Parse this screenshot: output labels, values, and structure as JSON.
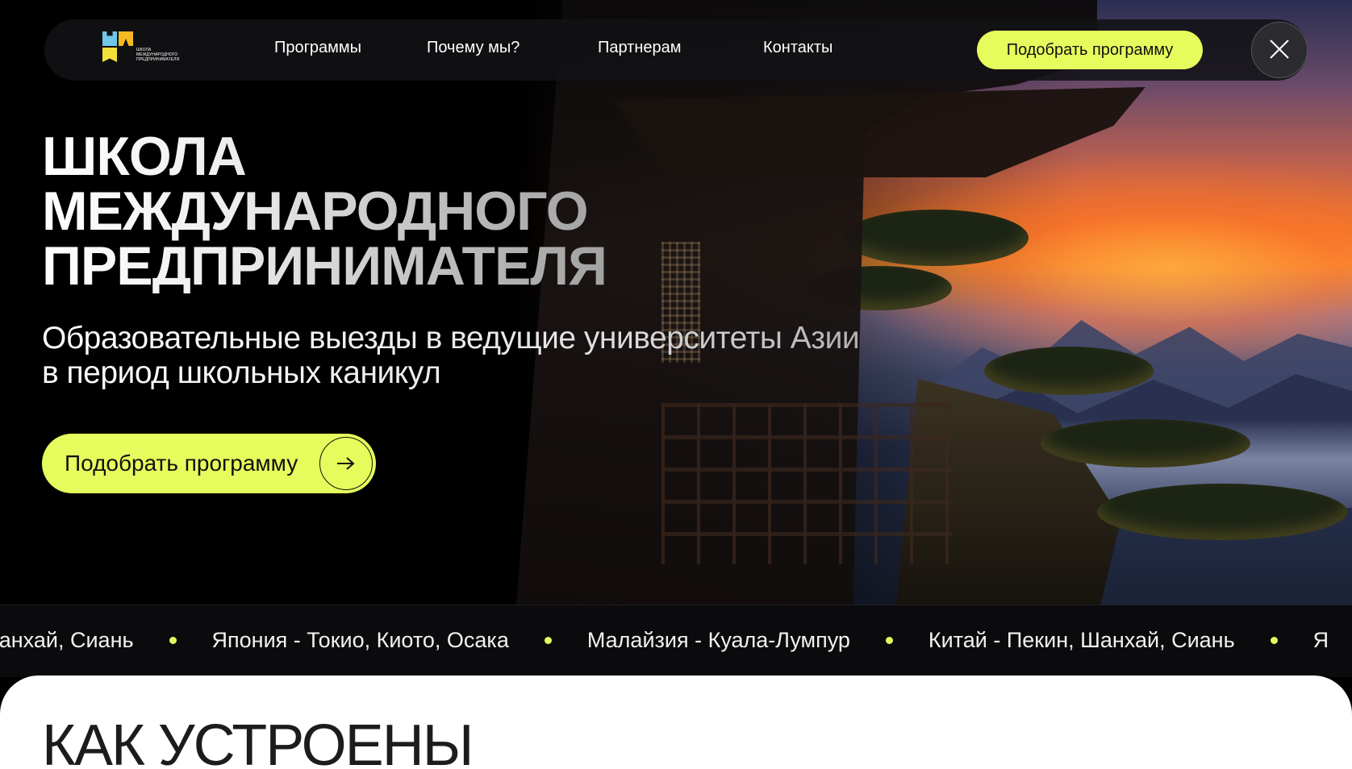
{
  "logo": {
    "text_lines": [
      "ШКОЛА",
      "МЕЖДУНАРОДНОГО",
      "ПРЕДПРИНИМАТЕЛЯ"
    ],
    "colors": [
      "#6fc7ea",
      "#f5b921",
      "#f2e13a"
    ]
  },
  "nav": {
    "items": [
      {
        "label": "Программы"
      },
      {
        "label": "Почему мы?"
      },
      {
        "label": "Партнерам"
      },
      {
        "label": "Контакты"
      }
    ],
    "cta_label": "Подобрать программу",
    "close_icon": "close-icon"
  },
  "hero": {
    "title_lines": [
      "ШКОЛА",
      "МЕЖДУНАРОДНОГО",
      "ПРЕДПРИНИМАТЕЛЯ"
    ],
    "subtitle_lines": [
      "Образовательные выезды в ведущие университеты Азии",
      "в период школьных каникул"
    ],
    "cta_label": "Подобрать программу",
    "cta_icon": "arrow-right-icon"
  },
  "ticker": {
    "items": [
      "Шанхай, Сиань",
      "Япония - Токио, Киото, Осака",
      "Малайзия - Куала-Лумпур",
      "Китай - Пекин, Шанхай, Сиань",
      "Я"
    ]
  },
  "section": {
    "title": "КАК УСТРОЕНЫ"
  },
  "colors": {
    "accent": "#e6fb5c",
    "background": "#000000",
    "navbar": "#121216",
    "section_bg": "#ffffff"
  }
}
